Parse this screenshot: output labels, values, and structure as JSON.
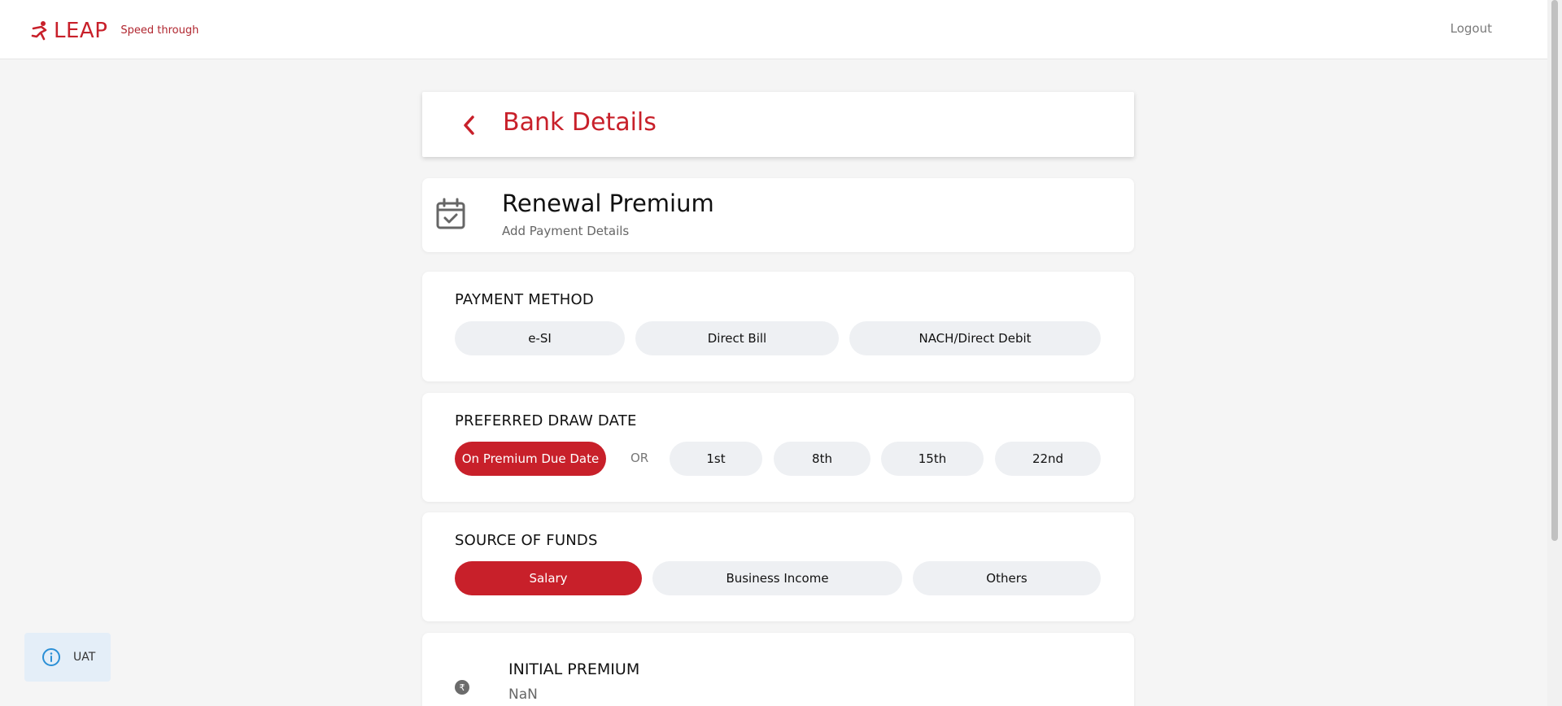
{
  "header": {
    "brand": "LEAP",
    "tagline": "Speed through",
    "logout_label": "Logout"
  },
  "page": {
    "title": "Bank Details"
  },
  "renewal": {
    "title": "Renewal Premium",
    "subtitle": "Add Payment Details"
  },
  "payment_method": {
    "label": "PAYMENT METHOD",
    "options": [
      "e-SI",
      "Direct Bill",
      "NACH/Direct Debit"
    ],
    "selected": null
  },
  "draw_date": {
    "label": "PREFERRED DRAW DATE",
    "primary_option": "On Premium Due Date",
    "or_label": "OR",
    "options": [
      "1st",
      "8th",
      "15th",
      "22nd"
    ],
    "selected": "On Premium Due Date"
  },
  "source_of_funds": {
    "label": "SOURCE OF FUNDS",
    "options": [
      "Salary",
      "Business Income",
      "Others"
    ],
    "selected": "Salary"
  },
  "initial_premium": {
    "label": "INITIAL PREMIUM",
    "value": "NaN",
    "icon": "rupee-icon"
  },
  "env_badge": {
    "label": "UAT",
    "icon": "info-icon"
  },
  "colors": {
    "brand": "#c8202a",
    "pill_bg": "#eef0f3",
    "badge_bg": "#e4eef8"
  }
}
